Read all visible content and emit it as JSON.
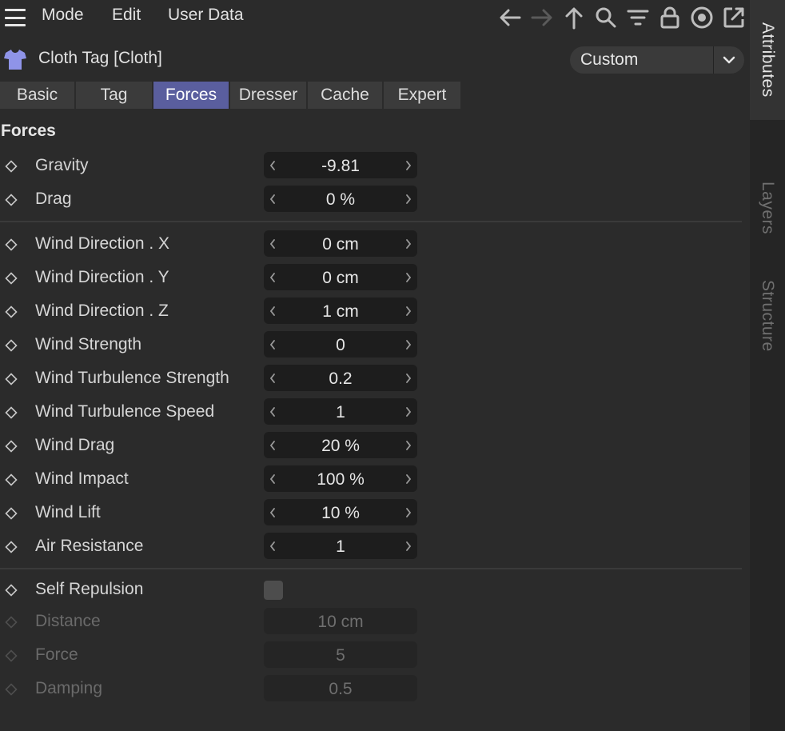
{
  "menu": {
    "mode": "Mode",
    "edit": "Edit",
    "user_data": "User Data"
  },
  "toolbar_icons": [
    "back-arrow-icon",
    "forward-arrow-icon",
    "up-arrow-icon",
    "search-icon",
    "filter-icon",
    "lock-icon",
    "target-icon",
    "external-window-icon"
  ],
  "title": "Cloth Tag [Cloth]",
  "preset": "Custom",
  "tabs": [
    {
      "label": "Basic",
      "active": false
    },
    {
      "label": "Tag",
      "active": false
    },
    {
      "label": "Forces",
      "active": true
    },
    {
      "label": "Dresser",
      "active": false
    },
    {
      "label": "Cache",
      "active": false
    },
    {
      "label": "Expert",
      "active": false
    }
  ],
  "section": "Forces",
  "params": [
    {
      "label": "Gravity",
      "value": "-9.81"
    },
    {
      "label": "Drag",
      "value": "0 %"
    },
    {
      "label": "Wind Direction . X",
      "value": "0 cm"
    },
    {
      "label": "Wind Direction . Y",
      "value": "0 cm"
    },
    {
      "label": "Wind Direction . Z",
      "value": "1 cm"
    },
    {
      "label": "Wind Strength",
      "value": "0"
    },
    {
      "label": "Wind Turbulence Strength",
      "value": "0.2"
    },
    {
      "label": "Wind Turbulence Speed",
      "value": "1"
    },
    {
      "label": "Wind Drag",
      "value": "20 %"
    },
    {
      "label": "Wind Impact",
      "value": "100 %"
    },
    {
      "label": "Wind Lift",
      "value": "10 %"
    },
    {
      "label": "Air Resistance",
      "value": "1"
    },
    {
      "label": "Self Repulsion",
      "checked": false
    },
    {
      "label": "Distance",
      "value": "10 cm",
      "disabled": true
    },
    {
      "label": "Force",
      "value": "5",
      "disabled": true
    },
    {
      "label": "Damping",
      "value": "0.5",
      "disabled": true
    }
  ],
  "side_tabs": [
    {
      "label": "Attributes",
      "active": true
    },
    {
      "label": "Layers",
      "active": false
    },
    {
      "label": "Structure",
      "active": false
    }
  ],
  "colors": {
    "active_tab": "#5a5e9e",
    "tag_icon": "#8f94e8",
    "background": "#2b2b2b",
    "field": "#1d1d1d"
  }
}
